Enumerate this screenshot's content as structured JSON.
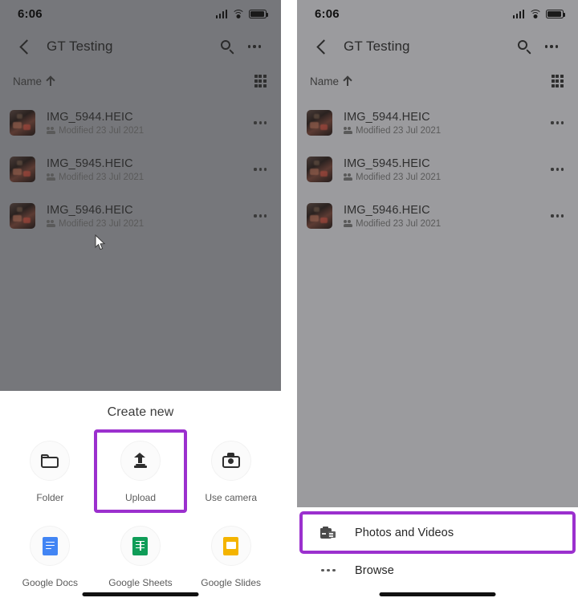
{
  "panels": [
    {
      "id": "left",
      "status": {
        "time": "6:06",
        "icons": [
          "signal-bars",
          "wifi",
          "battery"
        ]
      },
      "appbar": {
        "back": "back-chevron",
        "title": "GT Testing",
        "search": "search-icon",
        "overflow": "more-options-icon"
      },
      "sortbar": {
        "label": "Name",
        "direction": "↑",
        "view_toggle": "grid-view-icon"
      },
      "files": [
        {
          "name": "IMG_5944.HEIC",
          "meta": "Modified 23 Jul 2021"
        },
        {
          "name": "IMG_5945.HEIC",
          "meta": "Modified 23 Jul 2021"
        },
        {
          "name": "IMG_5946.HEIC",
          "meta": "Modified 23 Jul 2021"
        }
      ],
      "sheet": {
        "kind": "create-new",
        "title": "Create new",
        "items": [
          {
            "label": "Folder",
            "icon": "folder-icon",
            "highlighted": false
          },
          {
            "label": "Upload",
            "icon": "upload-icon",
            "highlighted": true
          },
          {
            "label": "Use camera",
            "icon": "camera-icon",
            "highlighted": false
          },
          {
            "label": "Google Docs",
            "icon": "google-docs-icon",
            "highlighted": false
          },
          {
            "label": "Google Sheets",
            "icon": "google-sheets-icon",
            "highlighted": false
          },
          {
            "label": "Google Slides",
            "icon": "google-slides-icon",
            "highlighted": false
          }
        ]
      }
    },
    {
      "id": "right",
      "status": {
        "time": "6:06",
        "icons": [
          "signal-bars",
          "wifi",
          "battery"
        ]
      },
      "appbar": {
        "back": "back-chevron",
        "title": "GT Testing",
        "search": "search-icon",
        "overflow": "more-options-icon"
      },
      "sortbar": {
        "label": "Name",
        "direction": "↑",
        "view_toggle": "grid-view-icon"
      },
      "files": [
        {
          "name": "IMG_5944.HEIC",
          "meta": "Modified 23 Jul 2021"
        },
        {
          "name": "IMG_5945.HEIC",
          "meta": "Modified 23 Jul 2021"
        },
        {
          "name": "IMG_5946.HEIC",
          "meta": "Modified 23 Jul 2021"
        }
      ],
      "sheet": {
        "kind": "upload-source",
        "items": [
          {
            "label": "Photos and Videos",
            "icon": "photos-videos-icon",
            "highlighted": true
          },
          {
            "label": "Browse",
            "icon": "browse-dots-icon",
            "highlighted": false
          }
        ]
      }
    }
  ],
  "colors": {
    "highlight": "#9b30ce",
    "left_scrim": "#76777b",
    "right_scrim": "#9b9b9e",
    "docs_blue": "#4285f4",
    "sheets_green": "#0f9d58",
    "slides_yellow": "#f4b400"
  }
}
